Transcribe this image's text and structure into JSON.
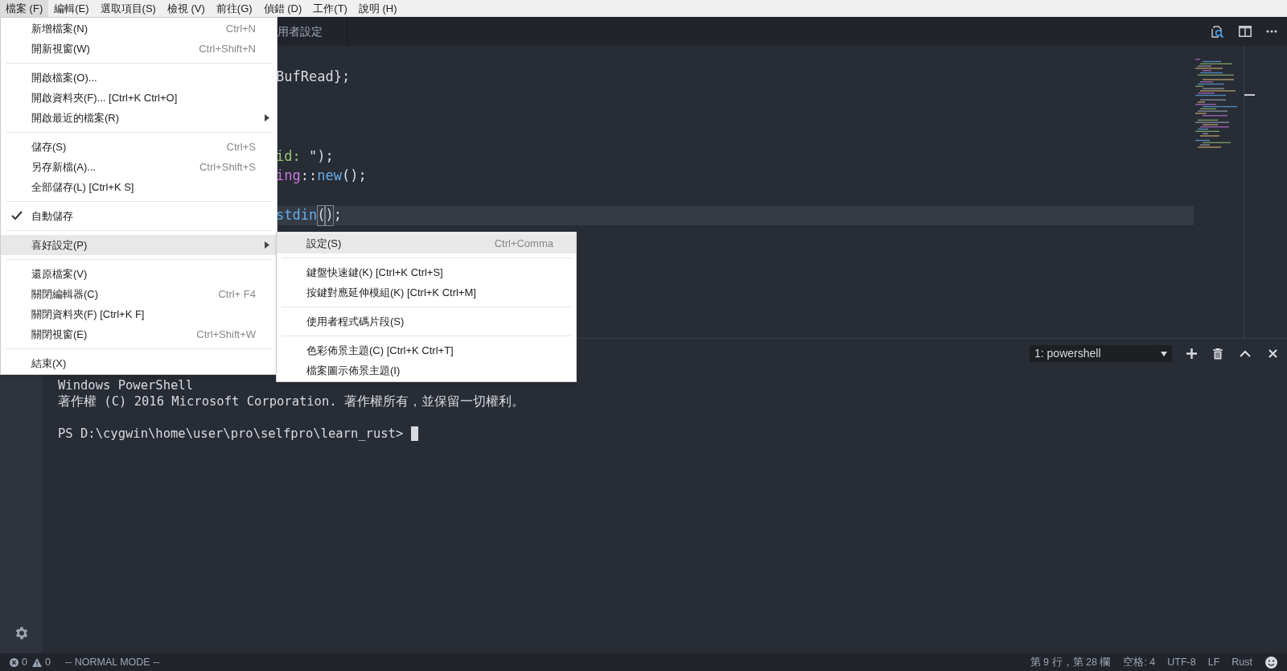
{
  "menubar": [
    {
      "label": "檔案 (F)",
      "selected": true
    },
    {
      "label": "編輯(E)",
      "selected": false
    },
    {
      "label": "選取項目(S)",
      "selected": false
    },
    {
      "label": "檢視 (V)",
      "selected": false
    },
    {
      "label": "前往(G)",
      "selected": false
    },
    {
      "label": "偵錯 (D)",
      "selected": false
    },
    {
      "label": "工作(T)",
      "selected": false
    },
    {
      "label": "說明 (H)",
      "selected": false
    }
  ],
  "editor_tab": {
    "label": "用者設定"
  },
  "code_lines": [
    {
      "tokens": [
        {
          "text": "BufRead};",
          "color": "#d7dae0"
        }
      ]
    },
    {
      "tokens": [
        {
          "text": "id: ",
          "color": "#98c379"
        },
        {
          "text": "\");",
          "color": "#d7dae0"
        }
      ]
    },
    {
      "tokens": [
        {
          "text": "ing",
          "color": "#c678dd"
        },
        {
          "text": "::",
          "color": "#d7dae0"
        },
        {
          "text": "new",
          "color": "#61afef"
        },
        {
          "text": "();",
          "color": "#d7dae0"
        }
      ]
    },
    {
      "current": true,
      "tokens": [
        {
          "text": "stdin",
          "color": "#61afef"
        },
        {
          "text": "(",
          "color": "#d7dae0",
          "bracket_match": true
        },
        {
          "text": ")",
          "color": "#d7dae0",
          "bracket_match": true
        },
        {
          "text": ";",
          "color": "#d7dae0"
        }
      ]
    }
  ],
  "file_menu": {
    "groups": [
      [
        {
          "label": "新增檔案(N)",
          "shortcut": "Ctrl+N",
          "submenu": false,
          "checked": false,
          "selected": false
        },
        {
          "label": "開新視窗(W)",
          "shortcut": "Ctrl+Shift+N",
          "submenu": false,
          "checked": false,
          "selected": false
        }
      ],
      [
        {
          "label": "開啟檔案(O)...",
          "submenu": false,
          "checked": false,
          "selected": false
        },
        {
          "label": "開啟資料夾(F)... [Ctrl+K Ctrl+O]",
          "submenu": false,
          "checked": false,
          "selected": false
        },
        {
          "label": "開啟最近的檔案(R)",
          "submenu": true,
          "checked": false,
          "selected": false
        }
      ],
      [
        {
          "label": "儲存(S)",
          "shortcut": "Ctrl+S",
          "submenu": false,
          "checked": false,
          "selected": false
        },
        {
          "label": "另存新檔(A)...",
          "shortcut": "Ctrl+Shift+S",
          "submenu": false,
          "checked": false,
          "selected": false
        },
        {
          "label": "全部儲存(L) [Ctrl+K S]",
          "submenu": false,
          "checked": false,
          "selected": false
        }
      ],
      [
        {
          "label": "自動儲存",
          "submenu": false,
          "checked": true,
          "selected": false
        }
      ],
      [
        {
          "label": "喜好設定(P)",
          "submenu": true,
          "checked": false,
          "selected": true
        }
      ],
      [
        {
          "label": "還原檔案(V)",
          "submenu": false,
          "checked": false,
          "selected": false
        },
        {
          "label": "關閉編輯器(C)",
          "shortcut": "Ctrl+ F4",
          "submenu": false,
          "checked": false,
          "selected": false
        },
        {
          "label": "關閉資料夾(F) [Ctrl+K F]",
          "submenu": false,
          "checked": false,
          "selected": false
        },
        {
          "label": "關閉視窗(E)",
          "shortcut": "Ctrl+Shift+W",
          "submenu": false,
          "checked": false,
          "selected": false
        }
      ],
      [
        {
          "label": "結束(X)",
          "submenu": false,
          "checked": false,
          "selected": false
        }
      ]
    ]
  },
  "preferences_submenu": {
    "groups": [
      [
        {
          "label": "設定(S)",
          "shortcut": "Ctrl+Comma",
          "selected": true
        }
      ],
      [
        {
          "label": "鍵盤快速鍵(K) [Ctrl+K Ctrl+S]",
          "selected": false
        },
        {
          "label": "按鍵對應延伸模組(K) [Ctrl+K Ctrl+M]",
          "selected": false
        }
      ],
      [
        {
          "label": "使用者程式碼片段(S)",
          "selected": false
        }
      ],
      [
        {
          "label": "色彩佈景主題(C) [Ctrl+K Ctrl+T]",
          "selected": false
        },
        {
          "label": "檔案圖示佈景主題(I)",
          "selected": false
        }
      ]
    ]
  },
  "terminal": {
    "selector": "1: powershell",
    "lines": [
      {
        "text": "Windows PowerShell"
      },
      {
        "text": "著作權 (C) 2016 Microsoft Corporation. 著作權所有，並保留一切權利。"
      },
      {
        "text": "PS D:\\cygwin\\home\\user\\pro\\selfpro\\learn_rust> ",
        "blank_before": true
      }
    ]
  },
  "status_bar": {
    "errors": "0",
    "warnings": "0",
    "mode": "-- NORMAL MODE --",
    "position": "第 9 行，第 28 欄",
    "indent": "空格: 4",
    "encoding": "UTF-8",
    "eol": "LF",
    "language": "Rust"
  }
}
